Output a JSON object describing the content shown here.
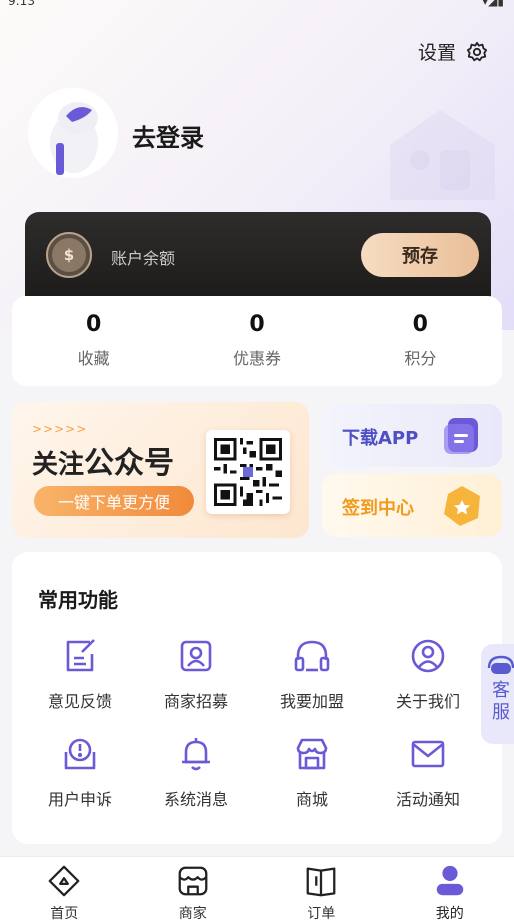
{
  "header": {
    "settings_label": "设置",
    "login_label": "去登录"
  },
  "balance": {
    "label": "账户余额",
    "deposit_label": "预存"
  },
  "stats": [
    {
      "value": "0",
      "label": "收藏"
    },
    {
      "value": "0",
      "label": "优惠券"
    },
    {
      "value": "0",
      "label": "积分"
    }
  ],
  "promo": {
    "arrows": ">>>>>",
    "title_a": "关注",
    "title_b": "公众号",
    "pill": "一键下单更方便"
  },
  "side_cards": {
    "download": "下载APP",
    "signin": "签到中心"
  },
  "features": {
    "title": "常用功能",
    "items": [
      {
        "label": "意见反馈",
        "icon": "feedback-icon"
      },
      {
        "label": "商家招募",
        "icon": "merchant-recruit-icon"
      },
      {
        "label": "我要加盟",
        "icon": "join-icon"
      },
      {
        "label": "关于我们",
        "icon": "about-icon"
      },
      {
        "label": "用户申诉",
        "icon": "appeal-icon"
      },
      {
        "label": "系统消息",
        "icon": "bell-icon"
      },
      {
        "label": "商城",
        "icon": "mall-icon"
      },
      {
        "label": "活动通知",
        "icon": "mail-icon"
      }
    ]
  },
  "service": {
    "label": "客服"
  },
  "tabs": [
    {
      "label": "首页",
      "icon": "home-icon"
    },
    {
      "label": "商家",
      "icon": "store-icon"
    },
    {
      "label": "订单",
      "icon": "order-icon"
    },
    {
      "label": "我的",
      "icon": "profile-icon",
      "active": true
    }
  ],
  "colors": {
    "accent": "#5b5bd0",
    "orange": "#f18a3b",
    "gold": "#f29a1c",
    "dark_card": "#1c1b1a"
  }
}
